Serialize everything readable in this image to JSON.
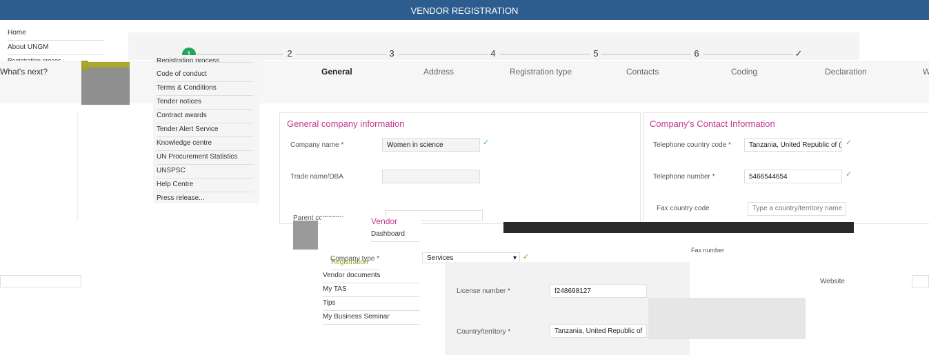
{
  "header": {
    "title": "VENDOR REGISTRATION"
  },
  "left_nav": [
    "Home",
    "About UNGM",
    "Registration proces..."
  ],
  "about_submenu": [
    "Registration process",
    "Code of conduct",
    "Terms & Conditions",
    "Tender notices",
    "Contract awards",
    "Tender Alert Service",
    "Knowledge centre",
    "UN Procurement Statistics",
    "UNSPSC",
    "Help Centre",
    "Press release..."
  ],
  "vendor_menu": {
    "title": "Vendor",
    "items": [
      "Dashboard",
      "Registration",
      "Vendor documents",
      "My TAS",
      "Tips",
      "My Business Seminar"
    ]
  },
  "whats_next": "What's next?",
  "stepper": {
    "steps": [
      "1",
      "2",
      "3",
      "4",
      "5",
      "6",
      "✓"
    ]
  },
  "tabs": [
    "General",
    "Address",
    "Registration type",
    "Contacts",
    "Coding",
    "Declaration",
    "W"
  ],
  "general_panel": {
    "title": "General company information",
    "company_name_label": "Company name *",
    "company_name_value": "Women in science",
    "trade_name_label": "Trade name/DBA",
    "trade_name_value": "",
    "parent_company_label": "Parent company",
    "company_type_label": "Company type *",
    "company_type_value": "Services",
    "license_label": "License number *",
    "license_value": "f248698127",
    "country_label": "Country/territory *",
    "country_value": "Tanzania, United Republic of"
  },
  "contact_panel": {
    "title": "Company's Contact Information",
    "tel_code_label": "Telephone country code *",
    "tel_code_value": "Tanzania, United Republic of (+",
    "tel_number_label": "Telephone number *",
    "tel_number_value": "5466544654",
    "fax_code_label": "Fax country code",
    "fax_code_placeholder": "Type a country/territory name",
    "fax_number_label": "Fax number",
    "website_label": "Website"
  }
}
